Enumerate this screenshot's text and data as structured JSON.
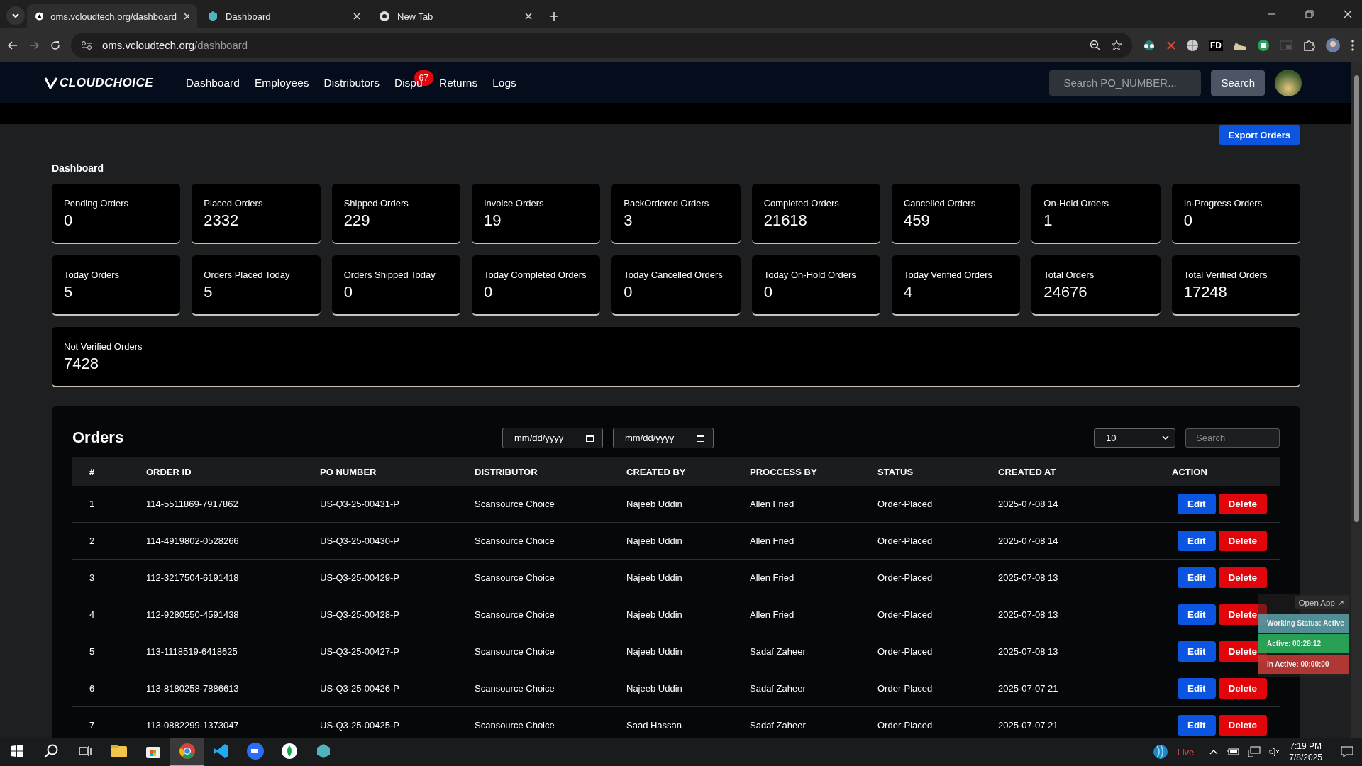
{
  "browser": {
    "tabs": [
      {
        "title": "oms.vcloudtech.org/dashboard",
        "selected": true
      },
      {
        "title": "Dashboard",
        "selected": false
      },
      {
        "title": "New Tab",
        "selected": false
      }
    ],
    "url_host": "oms.vcloudtech.org",
    "url_path": "/dashboard",
    "extension_label": "FD"
  },
  "navbar": {
    "logo": "CLOUDCHOICE",
    "links": [
      {
        "label": "Dashboard"
      },
      {
        "label": "Employees"
      },
      {
        "label": "Distributors"
      },
      {
        "label": "Dispu",
        "badge": "67"
      },
      {
        "label": "Returns"
      },
      {
        "label": "Logs"
      }
    ],
    "search_placeholder": "Search PO_NUMBER...",
    "search_button": "Search"
  },
  "export_button": "Export Orders",
  "section_title": "Dashboard",
  "stat_rows": [
    [
      {
        "label": "Pending Orders",
        "value": "0"
      },
      {
        "label": "Placed Orders",
        "value": "2332"
      },
      {
        "label": "Shipped Orders",
        "value": "229"
      },
      {
        "label": "Invoice Orders",
        "value": "19"
      },
      {
        "label": "BackOrdered Orders",
        "value": "3"
      },
      {
        "label": "Completed Orders",
        "value": "21618"
      },
      {
        "label": "Cancelled Orders",
        "value": "459"
      },
      {
        "label": "On-Hold Orders",
        "value": "1"
      },
      {
        "label": "In-Progress Orders",
        "value": "0"
      }
    ],
    [
      {
        "label": "Today Orders",
        "value": "5"
      },
      {
        "label": "Orders Placed Today",
        "value": "5"
      },
      {
        "label": "Orders Shipped Today",
        "value": "0"
      },
      {
        "label": "Today Completed Orders",
        "value": "0"
      },
      {
        "label": "Today Cancelled Orders",
        "value": "0"
      },
      {
        "label": "Today On-Hold Orders",
        "value": "0"
      },
      {
        "label": "Today Verified Orders",
        "value": "4"
      },
      {
        "label": "Total Orders",
        "value": "24676"
      },
      {
        "label": "Total Verified Orders",
        "value": "17248"
      }
    ],
    [
      {
        "label": "Not Verified Orders",
        "value": "7428"
      }
    ]
  ],
  "orders": {
    "title": "Orders",
    "date_from_placeholder": "mm/dd/yyyy",
    "date_to_placeholder": "mm/dd/yyyy",
    "page_size": "10",
    "search_placeholder": "Search",
    "columns": [
      "#",
      "ORDER ID",
      "PO NUMBER",
      "DISTRIBUTOR",
      "CREATED BY",
      "PROCCESS BY",
      "STATUS",
      "CREATED AT",
      "ACTION"
    ],
    "rows": [
      {
        "cells": [
          "1",
          "114-5511869-7917862",
          "US-Q3-25-00431-P",
          "Scansource Choice",
          "Najeeb Uddin",
          "Allen Fried",
          "Order-Placed",
          "2025-07-08 14"
        ],
        "actions": [
          "Edit",
          "Delete"
        ]
      },
      {
        "cells": [
          "2",
          "114-4919802-0528266",
          "US-Q3-25-00430-P",
          "Scansource Choice",
          "Najeeb Uddin",
          "Allen Fried",
          "Order-Placed",
          "2025-07-08 14"
        ],
        "actions": [
          "Edit",
          "Delete"
        ]
      },
      {
        "cells": [
          "3",
          "112-3217504-6191418",
          "US-Q3-25-00429-P",
          "Scansource Choice",
          "Najeeb Uddin",
          "Allen Fried",
          "Order-Placed",
          "2025-07-08 13"
        ],
        "actions": [
          "Edit",
          "Delete"
        ]
      },
      {
        "cells": [
          "4",
          "112-9280550-4591438",
          "US-Q3-25-00428-P",
          "Scansource Choice",
          "Najeeb Uddin",
          "Allen Fried",
          "Order-Placed",
          "2025-07-08 13"
        ],
        "actions": [
          "Edit",
          "Delete"
        ]
      },
      {
        "cells": [
          "5",
          "113-1118519-6418625",
          "US-Q3-25-00427-P",
          "Scansource Choice",
          "Najeeb Uddin",
          "Sadaf Zaheer",
          "Order-Placed",
          "2025-07-08 13"
        ],
        "actions": [
          "Edit",
          "Delete"
        ]
      },
      {
        "cells": [
          "6",
          "113-8180258-7886613",
          "US-Q3-25-00426-P",
          "Scansource Choice",
          "Najeeb Uddin",
          "Sadaf Zaheer",
          "Order-Placed",
          "2025-07-07 21"
        ],
        "actions": [
          "Edit",
          "Delete"
        ]
      },
      {
        "cells": [
          "7",
          "113-0882299-1373047",
          "US-Q3-25-00425-P",
          "Scansource Choice",
          "Saad Hassan",
          "Sadaf Zaheer",
          "Order-Placed",
          "2025-07-07 21"
        ],
        "actions": [
          "Edit",
          "Delete"
        ]
      }
    ]
  },
  "tracker": {
    "open_app": "Open App ↗",
    "lines": [
      {
        "kind": "status",
        "text": "Working Status: Active"
      },
      {
        "kind": "active",
        "text": "Active: 00:28:12"
      },
      {
        "kind": "inactive",
        "text": "In Active: 00:00:00"
      }
    ]
  },
  "taskbar": {
    "apps": [
      {
        "kind": "explorer",
        "active": false
      },
      {
        "kind": "store",
        "active": false
      },
      {
        "kind": "chrome",
        "active": true
      },
      {
        "kind": "vscode",
        "active": false
      },
      {
        "kind": "zoom",
        "active": false
      },
      {
        "kind": "leaf",
        "active": false
      },
      {
        "kind": "hexagon",
        "active": false
      }
    ],
    "live_label": "Live",
    "time": "7:19 PM",
    "date": "7/8/2025"
  }
}
